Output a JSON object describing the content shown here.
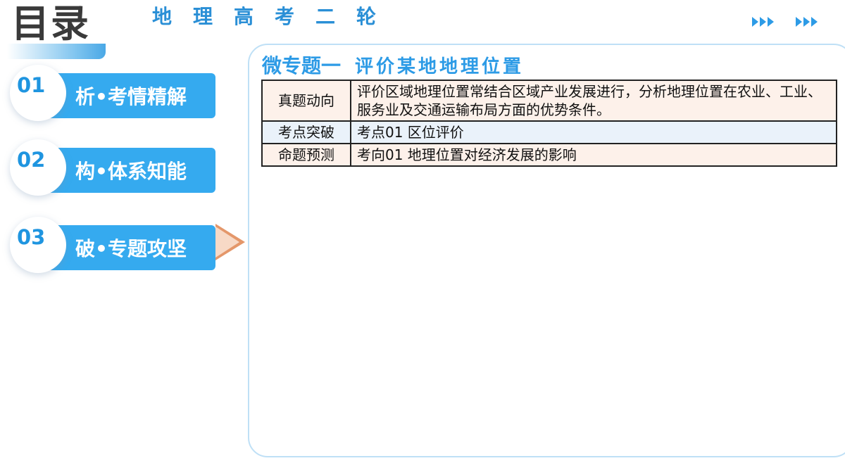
{
  "header": {
    "title": "目录",
    "subtitle": "地理高考二轮"
  },
  "nav": {
    "items": [
      {
        "num": "01",
        "label": "析•考情精解"
      },
      {
        "num": "02",
        "label": "构•体系知能"
      },
      {
        "num": "03",
        "label": "破•专题攻坚"
      }
    ],
    "active_index": 2
  },
  "panel": {
    "title_main": "微专题一",
    "title_sub": "评价某地地理位置",
    "rows": [
      {
        "head": "真题动向",
        "content": "评价区域地理位置常结合区域产业发展进行，分析地理位置在农业、工业、服务业及交通运输布局方面的优势条件。"
      },
      {
        "head": "考点突破",
        "content": "考点01 区位评价"
      },
      {
        "head": "命题预测",
        "content": "考向01 地理位置对经济发展的影响"
      }
    ]
  },
  "colors": {
    "accent_blue": "#35aaef",
    "title_dark": "#3a3a3a",
    "active_arrow": "#e4976a"
  }
}
